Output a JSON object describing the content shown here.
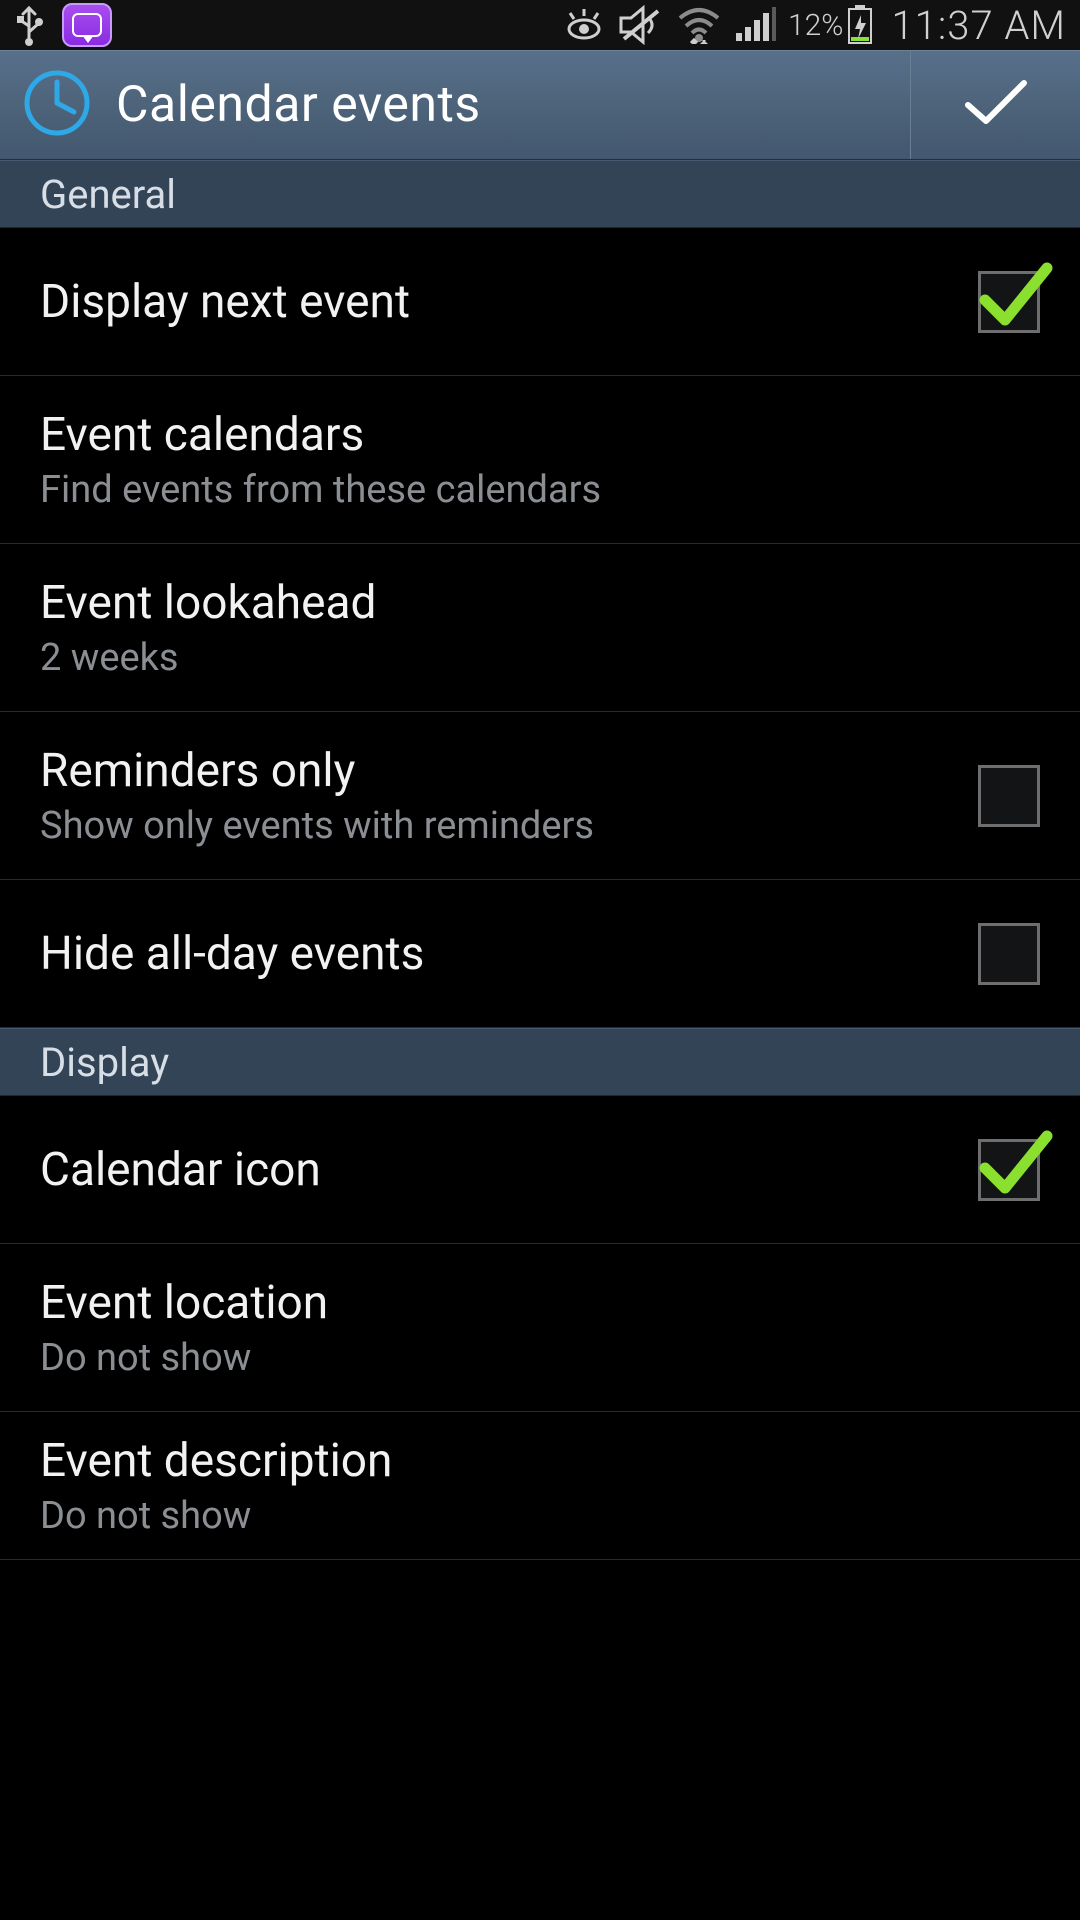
{
  "status": {
    "battery_pct": "12%",
    "time": "11:37 AM"
  },
  "header": {
    "title": "Calendar events"
  },
  "sections": {
    "general": {
      "label": "General",
      "display_next_event": {
        "title": "Display next event",
        "checked": true
      },
      "event_calendars": {
        "title": "Event calendars",
        "sub": "Find events from these calendars"
      },
      "event_lookahead": {
        "title": "Event lookahead",
        "sub": "2 weeks"
      },
      "reminders_only": {
        "title": "Reminders only",
        "sub": "Show only events with reminders",
        "checked": false
      },
      "hide_all_day": {
        "title": "Hide all-day events",
        "checked": false
      }
    },
    "display": {
      "label": "Display",
      "calendar_icon": {
        "title": "Calendar icon",
        "checked": true
      },
      "event_location": {
        "title": "Event location",
        "sub": "Do not show"
      },
      "event_description": {
        "title": "Event description",
        "sub": "Do not show"
      }
    }
  }
}
